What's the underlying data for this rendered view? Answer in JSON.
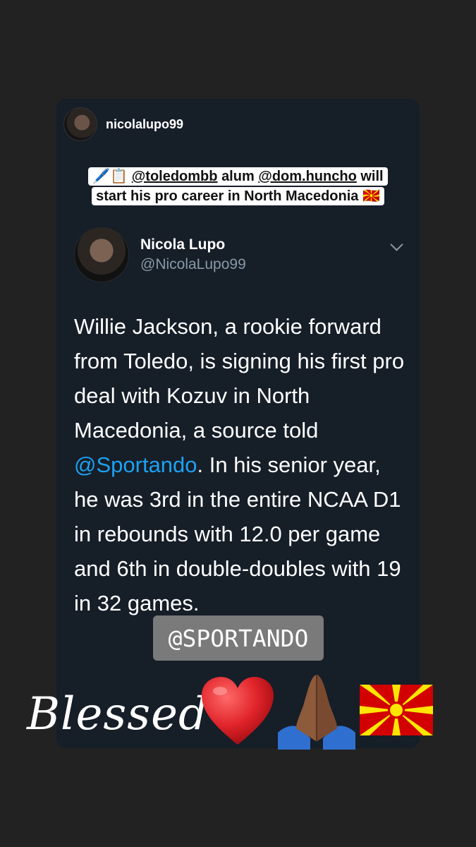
{
  "repost": {
    "username": "nicolalupo99"
  },
  "caption": {
    "emojis": "🖊️📋",
    "mention1": "@toledombb",
    "text1": "alum",
    "mention2": "@dom.huncho",
    "text2": "will start his pro career in North Macedonia",
    "flag_emoji": "🇲🇰"
  },
  "tweet": {
    "display_name": "Nicola Lupo",
    "handle": "@NicolaLupo99",
    "text_before": "Willie Jackson, a rookie forward from Toledo, is signing his first pro deal with Kozuv in North Macedonia, a source told ",
    "link": "@Sportando",
    "text_after": ". In his senior year, he was 3rd in the entire NCAA D1 in rebounds with 12.0 per game and 6th in double-doubles with 19 in 32 games."
  },
  "sticker": {
    "tag": "@SPORTANDO"
  },
  "signature": {
    "text": "Blessed",
    "icons": [
      "heart-icon",
      "praying-hands-icon",
      "north-macedonia-flag-icon"
    ]
  },
  "colors": {
    "background": "#222222",
    "card": "#161e28",
    "link": "#1da1f2",
    "handle": "#8899a6",
    "heart": "#e0242a",
    "flag_red": "#d20000",
    "flag_yellow": "#ffe600"
  }
}
